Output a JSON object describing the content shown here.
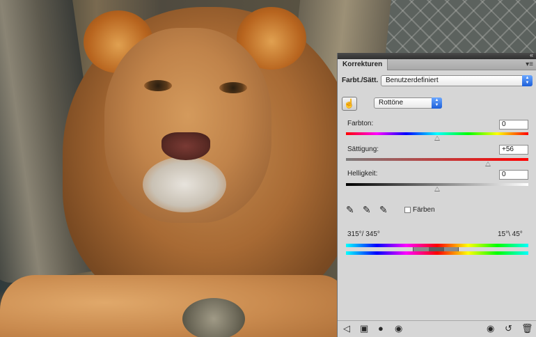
{
  "panel": {
    "title": "Korrekturen",
    "preset_label": "Farbt./Sätt.",
    "preset_value": "Benutzerdefiniert",
    "channel_value": "Rottöne",
    "hue": {
      "label": "Farbton:",
      "value": "0",
      "level": 0.5
    },
    "saturation": {
      "label": "Sättigung:",
      "value": "+56",
      "level": 0.78
    },
    "lightness": {
      "label": "Helligkeit:",
      "value": "0",
      "level": 0.5
    },
    "colorize_label": "Färben",
    "range_left": "315°/ 345°",
    "range_right": "15°\\ 45°"
  },
  "icons": {
    "collapse": "«",
    "menu": "▾≡",
    "hand_tool": "☝",
    "eyedropper": "✎",
    "back": "◁",
    "clip": "▣",
    "visibility": "●",
    "view_previous": "◉",
    "reset": "↺",
    "trash": "🗑"
  }
}
